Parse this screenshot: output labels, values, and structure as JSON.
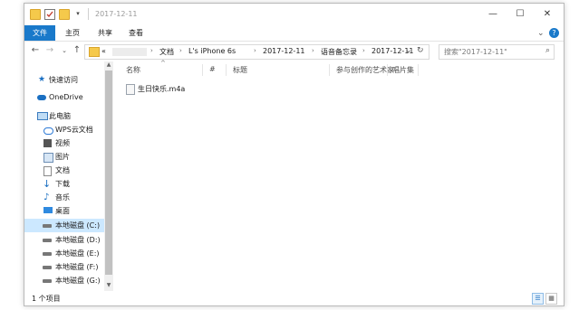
{
  "window": {
    "title": "2017-12-11",
    "minimize_icon": "minimize-icon",
    "maximize_icon": "maximize-icon",
    "close_icon": "close-icon"
  },
  "ribbon": {
    "tabs": [
      {
        "label": "文件"
      },
      {
        "label": "主页"
      },
      {
        "label": "共享"
      },
      {
        "label": "查看"
      }
    ],
    "help_label": "?"
  },
  "address": {
    "overflow": "«",
    "breadcrumbs": [
      "文档",
      "L's iPhone 6s",
      "2017-12-11",
      "语音备忘录",
      "2017-12-11"
    ],
    "search_placeholder": "搜索\"2017-12-11\""
  },
  "sidebar": {
    "items": [
      {
        "label": "快速访问",
        "icon": "star-icon"
      },
      {
        "label": "OneDrive",
        "icon": "cloud-icon"
      },
      {
        "label": "此电脑",
        "icon": "computer-icon"
      },
      {
        "label": "WPS云文档",
        "icon": "wps-cloud-icon"
      },
      {
        "label": "视频",
        "icon": "video-icon"
      },
      {
        "label": "图片",
        "icon": "picture-icon"
      },
      {
        "label": "文档",
        "icon": "document-icon"
      },
      {
        "label": "下载",
        "icon": "download-icon"
      },
      {
        "label": "音乐",
        "icon": "music-icon"
      },
      {
        "label": "桌面",
        "icon": "desktop-icon"
      },
      {
        "label": "本地磁盘 (C:)",
        "icon": "drive-icon"
      },
      {
        "label": "本地磁盘 (D:)",
        "icon": "drive-icon"
      },
      {
        "label": "本地磁盘 (E:)",
        "icon": "drive-icon"
      },
      {
        "label": "本地磁盘 (F:)",
        "icon": "drive-icon"
      },
      {
        "label": "本地磁盘 (G:)",
        "icon": "drive-icon"
      }
    ]
  },
  "columns": [
    "名称",
    "#",
    "标题",
    "参与创作的艺术家",
    "唱片集"
  ],
  "files": [
    {
      "name": "生日快乐.m4a",
      "icon": "audio-file-icon"
    }
  ],
  "status": {
    "count": "1 个项目"
  },
  "colors": {
    "accent": "#1979ca",
    "selection": "#cce8ff",
    "folder": "#f5c94b"
  }
}
